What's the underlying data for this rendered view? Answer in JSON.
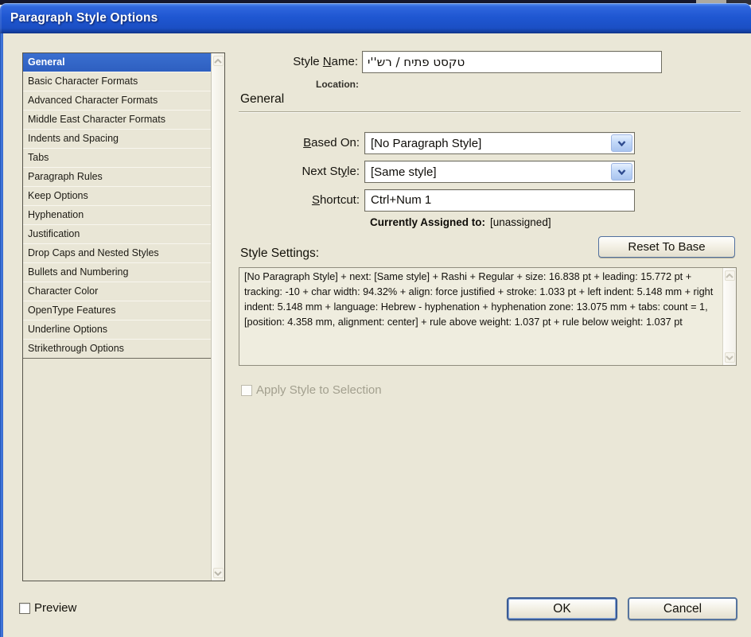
{
  "window": {
    "title": "Paragraph Style Options"
  },
  "sidebar": {
    "selected_index": 0,
    "items": [
      "General",
      "Basic Character Formats",
      "Advanced Character Formats",
      "Middle East Character Formats",
      "Indents and Spacing",
      "Tabs",
      "Paragraph Rules",
      "Keep Options",
      "Hyphenation",
      "Justification",
      "Drop Caps and Nested Styles",
      "Bullets and Numbering",
      "Character Color",
      "OpenType Features",
      "Underline Options",
      "Strikethrough Options"
    ]
  },
  "general_panel": {
    "style_name_label": [
      "Style ",
      "N",
      "ame:"
    ],
    "style_name_value": "טקסט פתיח / רש''י",
    "location_label": "Location:",
    "section_title": "General",
    "based_on_label": [
      "",
      "B",
      "ased On:"
    ],
    "based_on_value": "[No Paragraph Style]",
    "next_style_label": [
      "Next St",
      "y",
      "le:"
    ],
    "next_style_value": "[Same style]",
    "shortcut_label": [
      "",
      "S",
      "hortcut:"
    ],
    "shortcut_value": "Ctrl+Num 1",
    "assigned_label": "Currently Assigned to:",
    "assigned_value": "[unassigned]",
    "reset_button_label": "Reset To Base",
    "style_settings_label": "Style Settings:",
    "style_settings_text": "[No Paragraph Style] + next: [Same style] + Rashi + Regular + size: 16.838 pt + leading: 15.772 pt + tracking: -10 + char width: 94.32% + align: force justified + stroke: 1.033 pt + left indent: 5.148 mm + right indent: 5.148 mm + language: Hebrew - hyphenation + hyphenation zone: 13.075 mm + tabs: count = 1, [position: 4.358 mm, alignment: center]  + rule above weight: 1.037 pt + rule below weight: 1.037 pt",
    "apply_style_label": "Apply Style to Selection"
  },
  "footer": {
    "preview_label": "Preview",
    "ok_label": "OK",
    "cancel_label": "Cancel"
  },
  "colors": {
    "titlebar_blue": "#1F57D2",
    "selection_blue": "#3163C5",
    "dialog_bg": "#EAE7D7",
    "field_border": "#6F6D60"
  }
}
